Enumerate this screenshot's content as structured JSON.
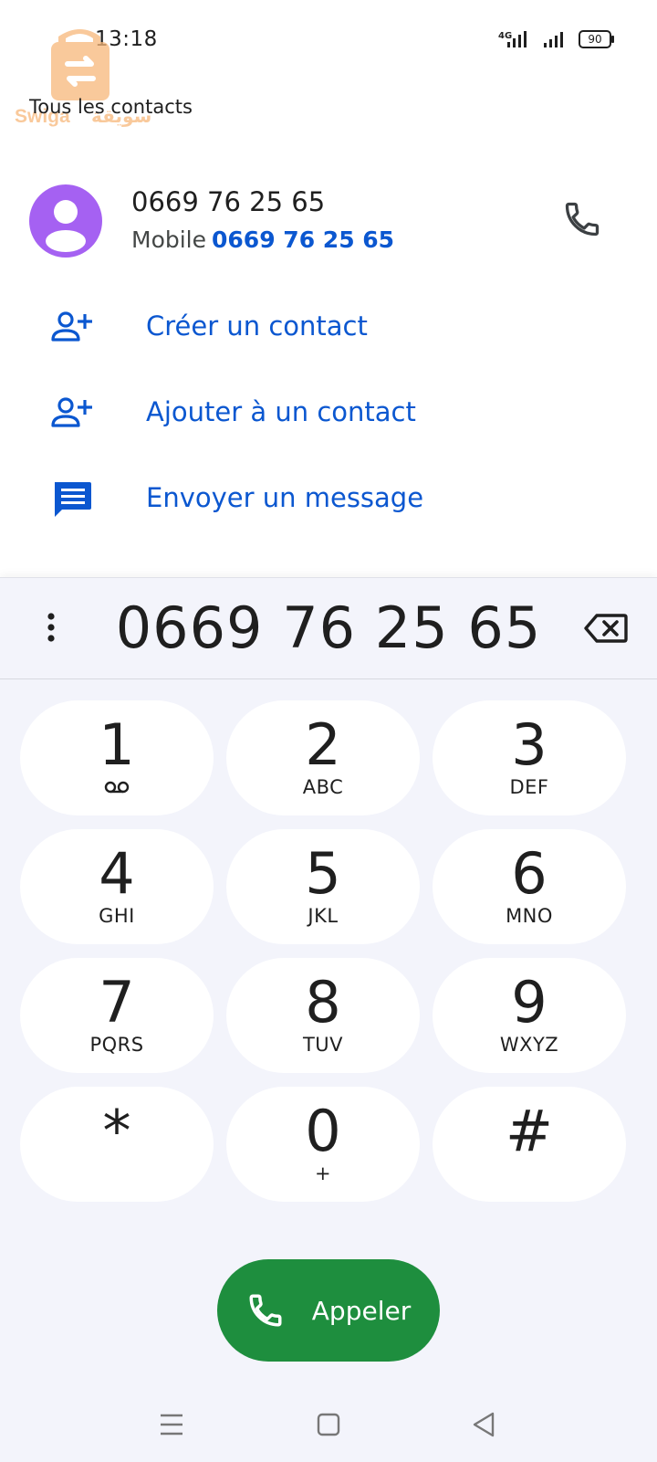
{
  "status_bar": {
    "time": "13:18",
    "network_type": "4G",
    "battery_level": "90"
  },
  "watermark": {
    "brand_latin": "Swiga",
    "brand_arabic": "سويقة",
    "color": "#f7b77a"
  },
  "header": {
    "back_label": "Tous les contacts"
  },
  "contact": {
    "number": "0669 76 25 65",
    "type_label": "Mobile",
    "sub_number": "0669 76 25 65",
    "avatar_color": "#a561f2"
  },
  "actions": [
    {
      "label": "Créer un contact",
      "icon": "person-add-icon"
    },
    {
      "label": "Ajouter à un contact",
      "icon": "person-add-icon"
    },
    {
      "label": "Envoyer un message",
      "icon": "message-icon"
    }
  ],
  "dialer": {
    "dialed_number": "0669 76 25 65",
    "keys": [
      {
        "digit": "1",
        "letters": ""
      },
      {
        "digit": "2",
        "letters": "ABC"
      },
      {
        "digit": "3",
        "letters": "DEF"
      },
      {
        "digit": "4",
        "letters": "GHI"
      },
      {
        "digit": "5",
        "letters": "JKL"
      },
      {
        "digit": "6",
        "letters": "MNO"
      },
      {
        "digit": "7",
        "letters": "PQRS"
      },
      {
        "digit": "8",
        "letters": "TUV"
      },
      {
        "digit": "9",
        "letters": "WXYZ"
      },
      {
        "digit": "*",
        "letters": ""
      },
      {
        "digit": "0",
        "letters": "+"
      },
      {
        "digit": "#",
        "letters": ""
      }
    ],
    "call_label": "Appeler"
  },
  "colors": {
    "accent_blue": "#0b57d0",
    "call_green": "#1e8e3e",
    "dialer_background": "#f3f4fb"
  }
}
